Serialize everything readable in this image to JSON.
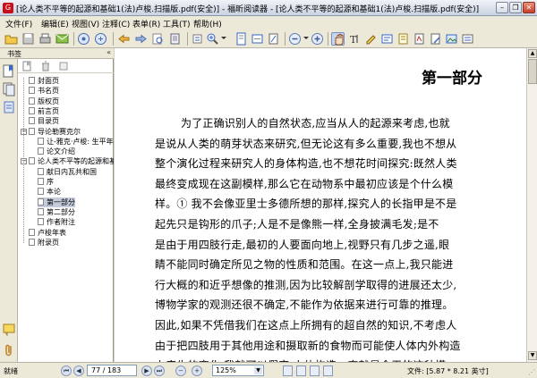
{
  "window": {
    "title": "[论人类不平等的起源和基础1(法)卢梭.扫描版.pdf(安全)] - 福昕阅读器 - [论人类不平等的起源和基础1(法)卢梭.扫描版.pdf(安全)]",
    "minimize": "–",
    "restore": "❐",
    "close": "✕"
  },
  "menu": [
    "文件(F)",
    "编辑(E)",
    "视图(V)",
    "注释(C)",
    "表单(R)",
    "工具(T)",
    "帮助(H)"
  ],
  "sidebar": {
    "header_label": "书签",
    "collapse_glyph": "«",
    "items": [
      {
        "label": "封面页",
        "level": 1
      },
      {
        "label": "书名页",
        "level": 1
      },
      {
        "label": "版权页",
        "level": 1
      },
      {
        "label": "前言页",
        "level": 1
      },
      {
        "label": "目录页",
        "level": 1
      },
      {
        "label": "导论勒赛克尔",
        "level": 1,
        "expanded": true
      },
      {
        "label": "让-雅克·卢梭: 生平年",
        "level": 2
      },
      {
        "label": "论文介绍",
        "level": 2
      },
      {
        "label": "论人类不平等的起源和基",
        "level": 1,
        "expanded": true
      },
      {
        "label": "献日内瓦共和国",
        "level": 2
      },
      {
        "label": "序",
        "level": 2
      },
      {
        "label": "本论",
        "level": 2
      },
      {
        "label": "第一部分",
        "level": 2,
        "selected": true
      },
      {
        "label": "第二部分",
        "level": 2
      },
      {
        "label": "作者附注",
        "level": 2
      },
      {
        "label": "卢梭年表",
        "level": 1
      },
      {
        "label": "附录页",
        "level": 1
      }
    ]
  },
  "document": {
    "heading": "第一部分",
    "lines": [
      "为了正确识别人的自然状态,应当从人的起源来考虑,也就",
      "是说从人类的萌芽状态来研究,但无论这有多么重要,我也不想从",
      "整个演化过程来研究人的身体构造,也不想花时间探究:既然人类",
      "最终变成现在这副模样,那么它在动物系中最初应该是个什么模",
      "样。① 我不会像亚里士多德所想的那样,探究人的长指甲是不是",
      "起先只是钩形的爪子;人是不是像熊一样,全身披满毛发;是不",
      "是由于用四肢行走,最初的人要面向地上,视野只有几步之遥,眼",
      "睛不能同时确定所见之物的性质和范围。在这一点上,我只能进",
      "行大概的和近乎想像的推测,因为比较解剖学取得的进展还太少,",
      "博物学家的观测还很不确定,不能作为依据来进行可靠的推理。",
      "因此,如果不凭借我们在这点上所拥有的超自然的知识,不考虑人",
      "由于把四肢用于其他用途和摄取新的食物而可能使人体内外构造",
      "上产生的变化,我就可以假定,人体构造一直就是今天的这种模"
    ]
  },
  "status": {
    "ready": "就绪",
    "page_field": "77 / 183",
    "zoom_field": "125%",
    "file_info": "文件: [5.87 * 8.21 英寸]",
    "grip": "⋰"
  },
  "nav": {
    "first": "⏮",
    "prev": "◀",
    "next": "▶",
    "last": "⏭",
    "zoom_dropdown": "▼"
  },
  "icons": {
    "accent": "#3a66c4",
    "brand_red": "#c8101a"
  }
}
